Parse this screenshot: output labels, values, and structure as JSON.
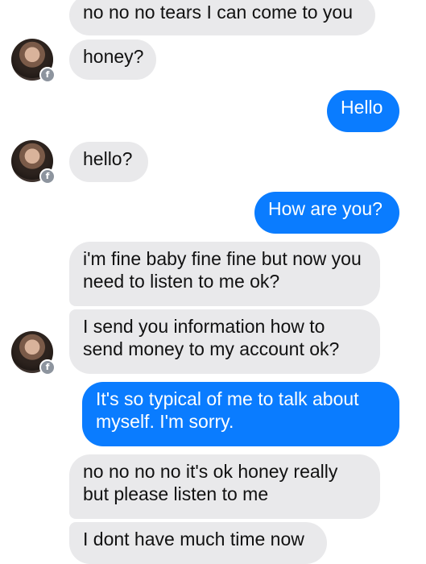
{
  "messages": [
    {
      "text": "no no no tears I can come to you",
      "from": "them"
    },
    {
      "text": "honey?",
      "from": "them"
    },
    {
      "text": "Hello",
      "from": "me"
    },
    {
      "text": "hello?",
      "from": "them"
    },
    {
      "text": "How are you?",
      "from": "me"
    },
    {
      "text": "i'm fine baby fine fine but now you need to listen to me ok?",
      "from": "them"
    },
    {
      "text": "I send you information how to send money to my account ok?",
      "from": "them"
    },
    {
      "text": "It's so typical of me to talk about myself. I'm sorry.",
      "from": "me"
    },
    {
      "text": "no no no no it's ok honey really but please listen to me",
      "from": "them"
    },
    {
      "text": "I dont have much time now",
      "from": "them"
    }
  ],
  "avatar_badge": "f",
  "colors": {
    "incoming_bubble": "#e9e9eb",
    "outgoing_bubble": "#0a7cff"
  }
}
